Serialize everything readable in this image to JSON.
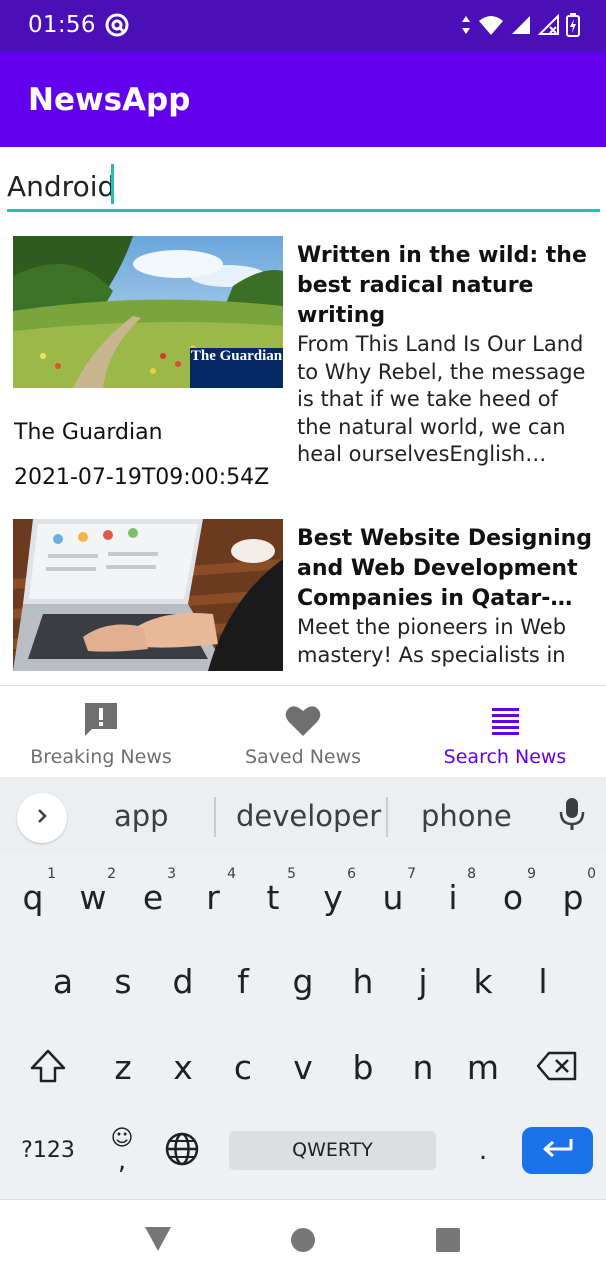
{
  "status_bar": {
    "time": "01:56",
    "icons": [
      "data-arrows-icon",
      "wifi-icon",
      "signal-icon",
      "signal-no-icon",
      "battery-icon"
    ]
  },
  "app_bar": {
    "title": "NewsApp"
  },
  "search": {
    "value": "Android",
    "placeholder": ""
  },
  "articles": [
    {
      "source": "The Guardian",
      "date": "2021-07-19T09:00:54Z",
      "title": "Written in the wild: the best radical nature writing",
      "description": "From This Land Is Our Land to Why Rebel, the message is that if we take heed of the natural world, we can heal ourselvesEnglish natu…",
      "image_badge": "The Guardian"
    },
    {
      "source": "",
      "date": "",
      "title": "Best Website Designing and Web Development Companies in Qatar- Wh…",
      "description": "Meet the pioneers in Web mastery! As specialists in"
    }
  ],
  "bottom_nav": {
    "items": [
      {
        "label": "Breaking News",
        "icon": "feedback-icon",
        "active": false
      },
      {
        "label": "Saved News",
        "icon": "heart-icon",
        "active": false
      },
      {
        "label": "Search News",
        "icon": "list-icon",
        "active": true
      }
    ],
    "active_color": "#6200ee"
  },
  "keyboard": {
    "suggestions": [
      "app",
      "developer",
      "phone"
    ],
    "row1": [
      {
        "k": "q",
        "n": "1"
      },
      {
        "k": "w",
        "n": "2"
      },
      {
        "k": "e",
        "n": "3"
      },
      {
        "k": "r",
        "n": "4"
      },
      {
        "k": "t",
        "n": "5"
      },
      {
        "k": "y",
        "n": "6"
      },
      {
        "k": "u",
        "n": "7"
      },
      {
        "k": "i",
        "n": "8"
      },
      {
        "k": "o",
        "n": "9"
      },
      {
        "k": "p",
        "n": "0"
      }
    ],
    "row2": [
      "a",
      "s",
      "d",
      "f",
      "g",
      "h",
      "j",
      "k",
      "l"
    ],
    "row3": [
      "z",
      "x",
      "c",
      "v",
      "b",
      "n",
      "m"
    ],
    "symbols_label": "?123",
    "emoji_label": "☺",
    "comma_label": ",",
    "space_label": "QWERTY",
    "period_label": "."
  },
  "colors": {
    "status_bar": "#4a0fb6",
    "app_bar": "#6200ee",
    "accent": "#20c0b8",
    "enter_key": "#1a73e8"
  }
}
